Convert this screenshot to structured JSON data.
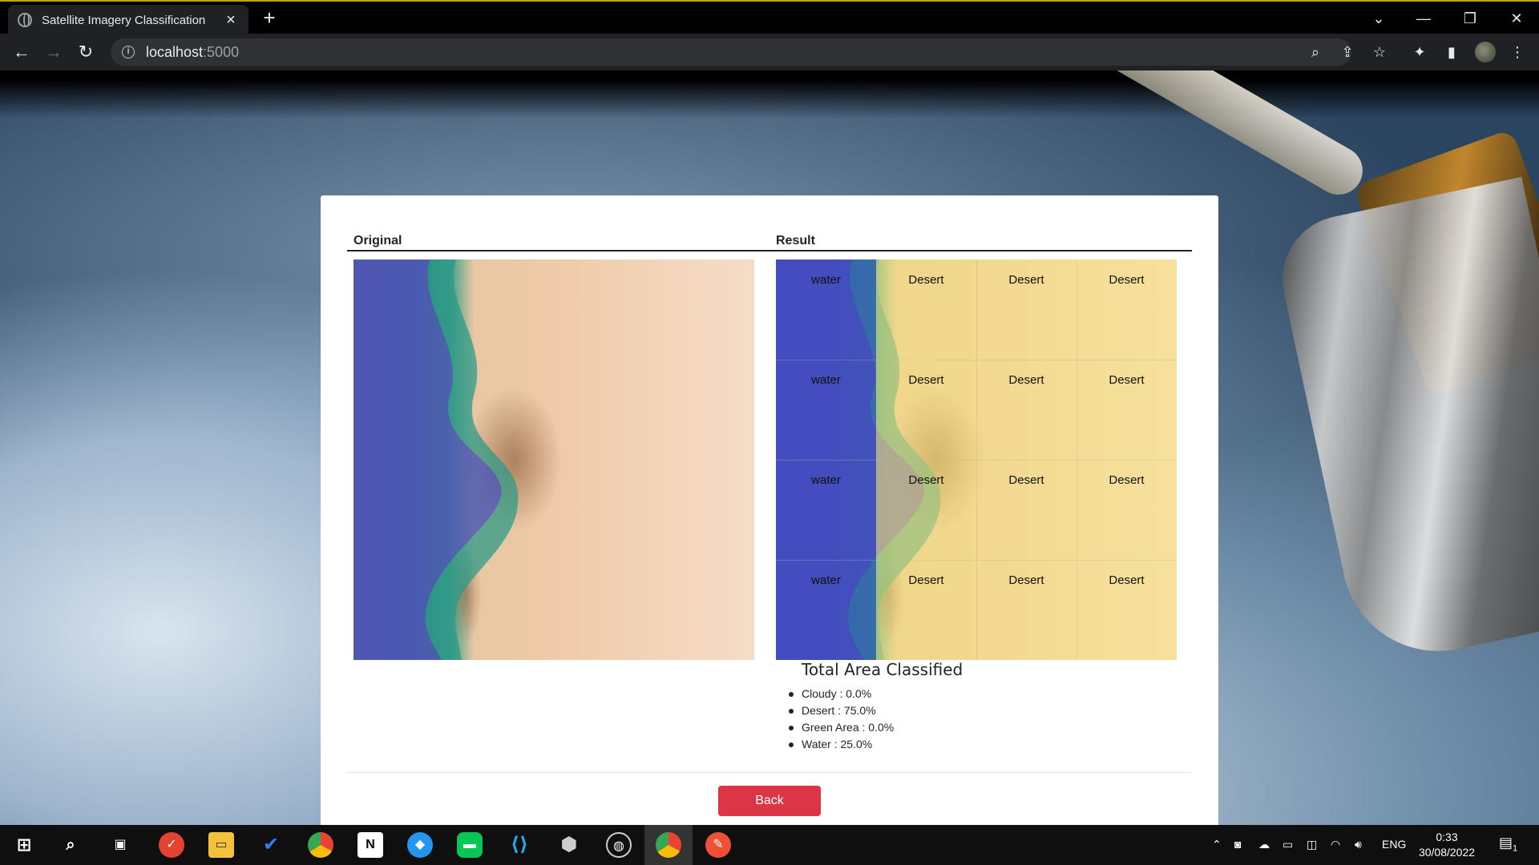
{
  "browser": {
    "tab_title": "Satellite Imagery Classification",
    "url_host": "localhost",
    "url_port": ":5000"
  },
  "page": {
    "header_original": "Original",
    "header_result": "Result",
    "grid_labels": [
      [
        "water",
        "Desert",
        "Desert",
        "Desert"
      ],
      [
        "water",
        "Desert",
        "Desert",
        "Desert"
      ],
      [
        "water",
        "Desert",
        "Desert",
        "Desert"
      ],
      [
        "water",
        "Desert",
        "Desert",
        "Desert"
      ]
    ],
    "summary": {
      "title": "Total Area Classified",
      "items": [
        "Cloudy : 0.0%",
        "Desert : 75.0%",
        "Green Area : 0.0%",
        "Water : 25.0%"
      ]
    },
    "back_label": "Back"
  },
  "taskbar": {
    "language": "ENG",
    "time": "0:33",
    "date": "30/08/2022",
    "notification_count": "1"
  },
  "colors": {
    "back_button": "#dc3545",
    "water_tint": "#3c46c8",
    "desert_tint": "#f6e478"
  }
}
